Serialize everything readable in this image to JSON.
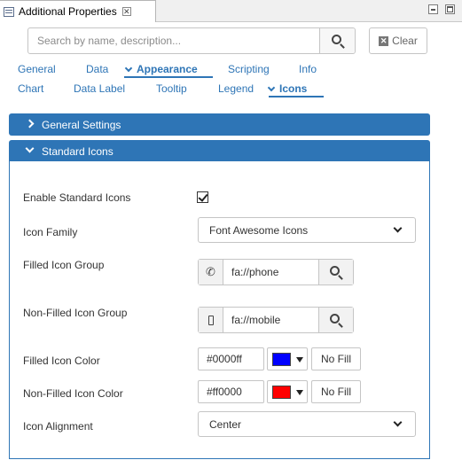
{
  "view": {
    "title": "Additional Properties"
  },
  "search": {
    "placeholder": "Search by name, description...",
    "value": "",
    "clear_label": "Clear"
  },
  "tabs_row1": [
    {
      "label": "General",
      "active": false
    },
    {
      "label": "Data",
      "active": false
    },
    {
      "label": "Appearance",
      "active": true
    },
    {
      "label": "Scripting",
      "active": false
    },
    {
      "label": "Info",
      "active": false
    }
  ],
  "tabs_row2": [
    {
      "label": "Chart",
      "active": false
    },
    {
      "label": "Data Label",
      "active": false
    },
    {
      "label": "Tooltip",
      "active": false
    },
    {
      "label": "Legend",
      "active": false
    },
    {
      "label": "Icons",
      "active": true
    }
  ],
  "panels": {
    "general": {
      "label": "General Settings",
      "expanded": false
    },
    "standard": {
      "label": "Standard Icons",
      "expanded": true
    }
  },
  "form": {
    "enable": {
      "label": "Enable Standard Icons",
      "checked": true
    },
    "family": {
      "label": "Icon Family",
      "value": "Font Awesome Icons"
    },
    "filled_group": {
      "label": "Filled Icon Group",
      "value": "fa://phone",
      "icon": "phone-icon"
    },
    "nonfilled_group": {
      "label": "Non-Filled Icon Group",
      "value": "fa://mobile",
      "icon": "mobile-icon"
    },
    "filled_color": {
      "label": "Filled Icon Color",
      "value": "#0000ff",
      "swatch": "#0000ff",
      "no_fill": "No Fill"
    },
    "nonfilled_color": {
      "label": "Non-Filled Icon Color",
      "value": "#ff0000",
      "swatch": "#ff0000",
      "no_fill": "No Fill"
    },
    "alignment": {
      "label": "Icon Alignment",
      "value": "Center"
    }
  },
  "colors": {
    "accent": "#2e75b6"
  }
}
